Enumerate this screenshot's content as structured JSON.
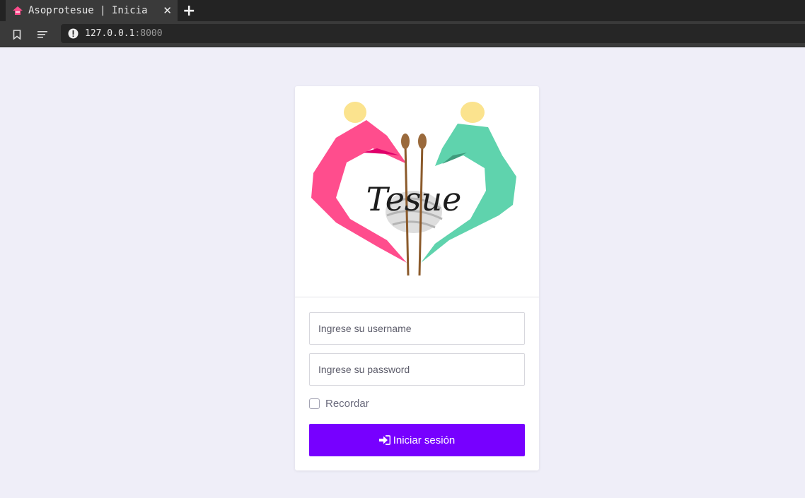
{
  "browser": {
    "tab_title": "Asoprotesue | Inicia",
    "url_host": "127.0.0.1",
    "url_port": ":8000"
  },
  "logo": {
    "wordmark": "Tesue",
    "colors": {
      "pink": "#ff4d8d",
      "green": "#5fd3ad",
      "head": "#fbe38e",
      "needle": "#8b5a2b"
    }
  },
  "login": {
    "username_placeholder": "Ingrese su username",
    "password_placeholder": "Ingrese su password",
    "remember_label": "Recordar",
    "submit_label": "Iniciar sesión"
  },
  "theme": {
    "accent": "#7700ff",
    "background": "#efeef8"
  }
}
